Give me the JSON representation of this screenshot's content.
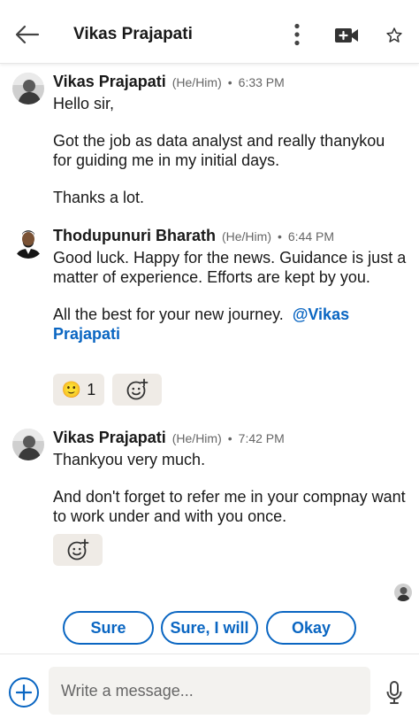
{
  "header": {
    "title": "Vikas Prajapati",
    "back_icon": "arrow-left-icon",
    "more_icon": "more-vertical-icon",
    "video_icon": "video-plus-icon",
    "star_icon": "star-outline-icon"
  },
  "messages": [
    {
      "sender": "Vikas Prajapati",
      "pronouns": "(He/Him)",
      "dot": "•",
      "time": "6:33 PM",
      "paragraphs": [
        "Hello sir,",
        "Got the job as data analyst and really thanykou for guiding me in my initial days.",
        "Thanks a lot."
      ]
    },
    {
      "sender": "Thodupunuri Bharath",
      "pronouns": "(He/Him)",
      "dot": "•",
      "time": "6:44 PM",
      "paragraphs": [
        "Good luck. Happy for the news. Guidance is just a matter of experience. Efforts are kept by you.",
        "All the best for your new journey."
      ],
      "mention": "@Vikas Prajapati",
      "reaction": {
        "emoji": "🙂",
        "count": "1"
      }
    },
    {
      "sender": "Vikas Prajapati",
      "pronouns": "(He/Him)",
      "dot": "•",
      "time": "7:42 PM",
      "paragraphs": [
        "Thankyou very much.",
        "And don't forget to refer me in your compnay want to work under and with you once."
      ]
    }
  ],
  "suggestions": [
    "Sure",
    "Sure, I will",
    "Okay"
  ],
  "composer": {
    "placeholder": "Write a message...",
    "add_icon": "plus-icon",
    "mic_icon": "microphone-icon"
  },
  "colors": {
    "accent": "#0a66c2",
    "reaction_bg": "#efebe6",
    "input_bg": "#f3f2ef"
  }
}
